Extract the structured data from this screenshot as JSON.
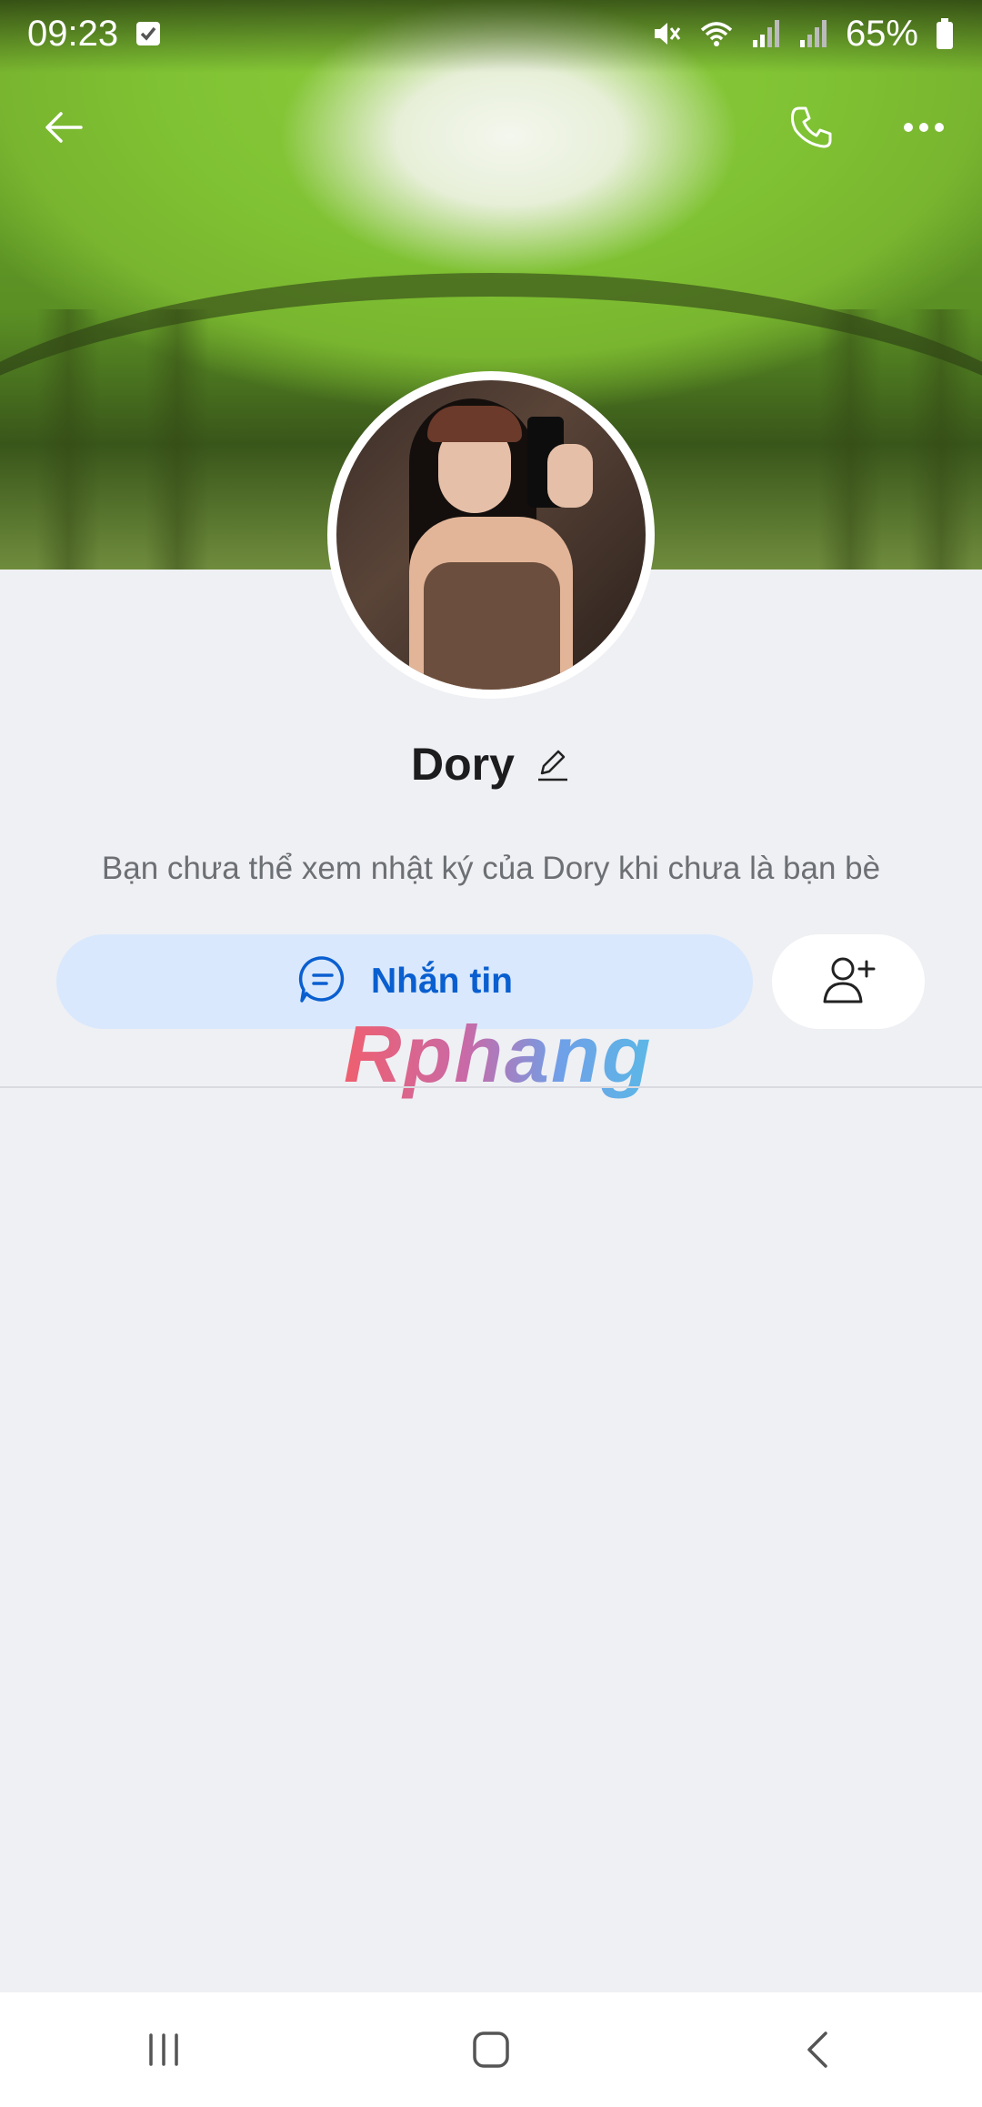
{
  "status_bar": {
    "time": "09:23",
    "battery": "65%",
    "icons": [
      "check-notification-icon",
      "mute-icon",
      "wifi-icon",
      "signal-icon",
      "signal-2-icon",
      "battery-icon"
    ]
  },
  "app_bar": {
    "icons": [
      "back-arrow-icon",
      "phone-icon",
      "more-icon"
    ]
  },
  "profile": {
    "name": "Dory",
    "notice": "Bạn chưa thể xem nhật ký của Dory khi chưa là bạn bè"
  },
  "actions": {
    "message_label": "Nhắn tin",
    "add_friend_icon": "add-friend-icon"
  },
  "watermark": "Rphang",
  "nav": {
    "icons": [
      "recent-apps-icon",
      "home-icon",
      "back-icon"
    ]
  },
  "colors": {
    "accent": "#0a5fd0",
    "message_button_bg": "#d9e8fc",
    "background": "#eff0f4"
  }
}
